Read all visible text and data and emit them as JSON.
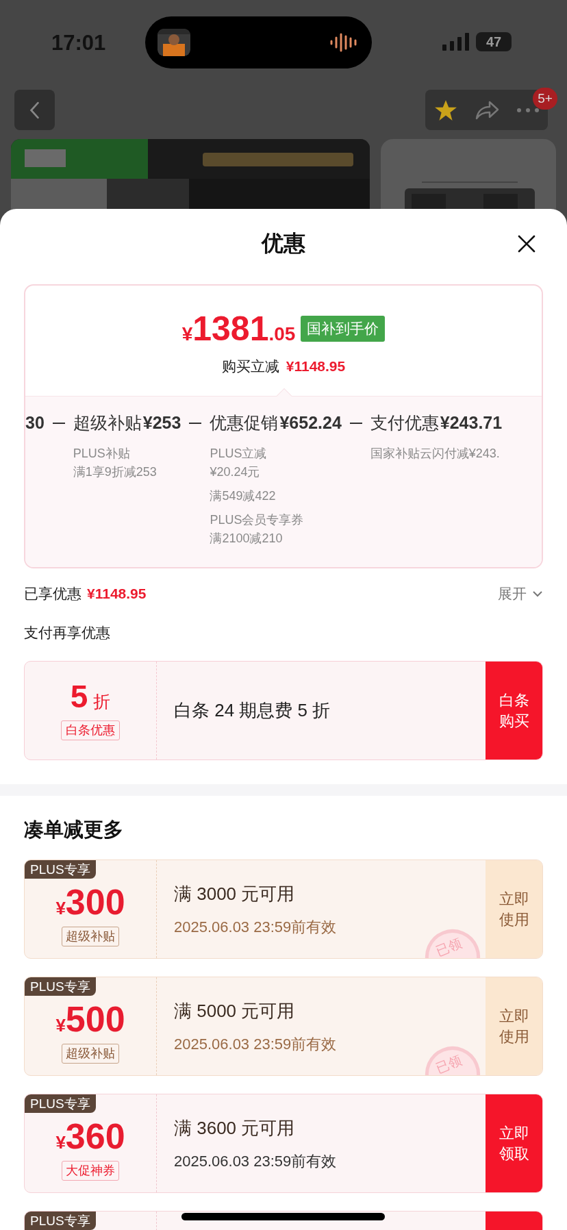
{
  "status_bar": {
    "time": "17:01",
    "battery": "47"
  },
  "nav": {
    "badge": "5+"
  },
  "sheet": {
    "title": "优惠",
    "price_card": {
      "currency": "¥",
      "price_int": "1381",
      "price_dec": ".05",
      "price_tag": "国补到手价",
      "discount_label": "购买立减",
      "discount_amount": "¥1148.95",
      "breakdown": [
        {
          "amount": "30"
        },
        {
          "name": "超级补贴",
          "amount": "¥253",
          "details": [
            [
              "PLUS补贴",
              "满1享9折减253"
            ]
          ]
        },
        {
          "name": "优惠促销",
          "amount": "¥652.24",
          "details": [
            [
              "PLUS立减",
              "¥20.24元"
            ],
            [
              "满549减422"
            ],
            [
              "PLUS会员专享券",
              "满2100减210"
            ]
          ]
        },
        {
          "name": "支付优惠",
          "amount": "¥243.71",
          "details": [
            [
              "国家补贴云闪付减¥243."
            ]
          ]
        }
      ]
    },
    "enjoyed": {
      "label": "已享优惠",
      "amount": "¥1148.95",
      "toggle": "展开",
      "expanded": false
    },
    "pay_title": "支付再享优惠",
    "pay_offer": {
      "value": "5",
      "unit": "折",
      "badge": "白条优惠",
      "text": "白条 24 期息费 5 折",
      "action": "白条购买"
    },
    "more_title": "凑单减更多",
    "coupons": [
      {
        "kind": "claimed",
        "tag": "PLUS专享",
        "currency": "¥",
        "amount": "300",
        "badge": "超级补贴",
        "title": "满 3000 元可用",
        "date": "2025.06.03 23:59前有效",
        "action": "立即使用",
        "stamp": "已领"
      },
      {
        "kind": "claimed",
        "tag": "PLUS专享",
        "currency": "¥",
        "amount": "500",
        "badge": "超级补贴",
        "title": "满 5000 元可用",
        "date": "2025.06.03 23:59前有效",
        "action": "立即使用",
        "stamp": "已领"
      },
      {
        "kind": "available",
        "tag": "PLUS专享",
        "currency": "¥",
        "amount": "360",
        "badge": "大促神券",
        "title": "满 3600 元可用",
        "date": "2025.06.03 23:59前有效",
        "action": "立即领取"
      },
      {
        "kind": "available",
        "tag": "PLUS专享"
      }
    ]
  }
}
